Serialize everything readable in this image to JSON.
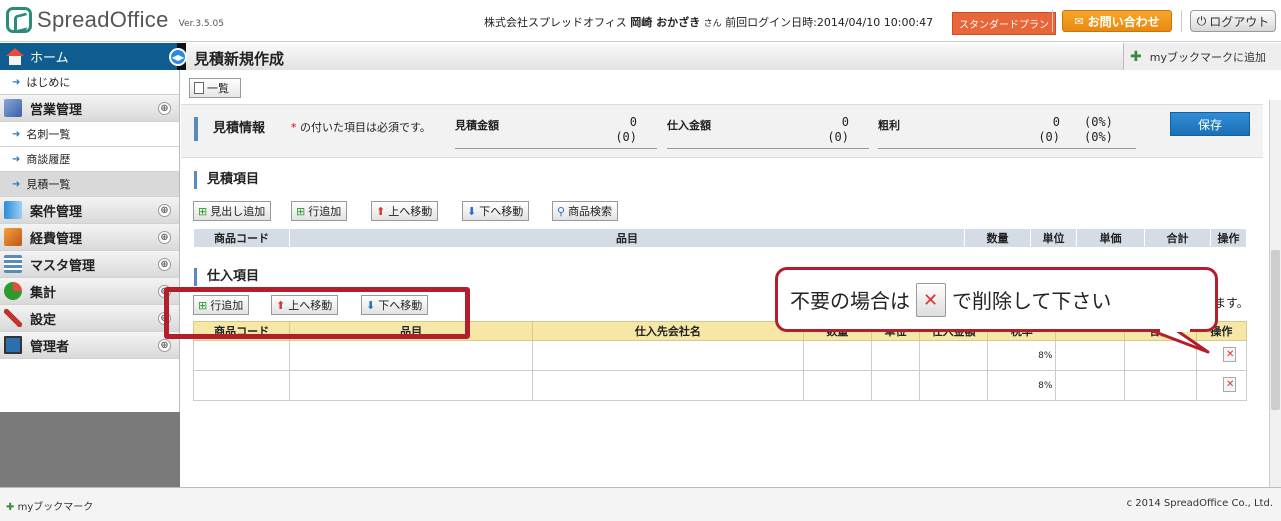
{
  "colors": {
    "brand": "#2a8c7a",
    "sidebar_blue": "#0f5d90",
    "save": "#1c6fb4",
    "annotation": "#b21e2c",
    "plan": "#e8663a",
    "contact": "#e98a10"
  },
  "header": {
    "logo_text": "SpreadOffice",
    "version": "Ver.3.5.05",
    "company": "株式会社スプレッドオフィス",
    "user_name": "岡崎 おかざき",
    "honorific": "さん",
    "last_login_label": "前回ログイン日時:",
    "last_login": "2014/04/10 10:00:47",
    "plan": "スタンダードプラン",
    "contact": "お問い合わせ",
    "logout": "ログアウト"
  },
  "titlebar": {
    "home": "ホーム",
    "page_title": "見積新規作成",
    "bookmark_add": "myブックマークに追加"
  },
  "sidebar": {
    "intro": "はじめに",
    "sales": "営業管理",
    "business_cards": "名刺一覧",
    "negotiations": "商談履歴",
    "estimates": "見積一覧",
    "projects": "案件管理",
    "expenses": "経費管理",
    "master": "マスタ管理",
    "totals": "集計",
    "settings": "設定",
    "admin": "管理者",
    "plus": "⊕"
  },
  "toolbar": {
    "list": "一覧"
  },
  "summary": {
    "title": "見積情報",
    "required_mark": "*",
    "required_note": "の付いた項目は必須です。",
    "estimate_label": "見積金額",
    "estimate_val": "0",
    "estimate_sub": "(0)",
    "purchase_label": "仕入金額",
    "purchase_val": "0",
    "purchase_sub": "(0)",
    "gross_label": "粗利",
    "gross_val": "0",
    "gross_sub": "(0)",
    "gross_pct": "(0%)",
    "gross_pct_sub": "(0%)",
    "save": "保存"
  },
  "estimate_items": {
    "title": "見積項目",
    "buttons": {
      "add_heading": "見出し追加",
      "add_row": "行追加",
      "move_up": "上へ移動",
      "move_down": "下へ移動",
      "search": "商品検索"
    },
    "columns": [
      "商品コード",
      "品目",
      "数量",
      "単位",
      "単価",
      "合計",
      "操作"
    ]
  },
  "purchase_items": {
    "title": "仕入項目",
    "buttons": {
      "add_row": "行追加",
      "move_up": "上へ移動",
      "move_down": "下へ移動"
    },
    "columns": [
      "商品コード",
      "品目",
      "仕入先会社名",
      "数量",
      "単位",
      "仕入金額",
      "税率",
      "",
      "合計",
      "操作"
    ],
    "rows": [
      {
        "tax": "8%"
      },
      {
        "tax": "8%"
      }
    ],
    "trailing_text": "ます。"
  },
  "callout": {
    "before": "不要の場合は",
    "after": "で削除して下さい"
  },
  "footer": {
    "bookmark": "myブックマーク",
    "copyright": "c 2014 SpreadOffice Co., Ltd."
  }
}
